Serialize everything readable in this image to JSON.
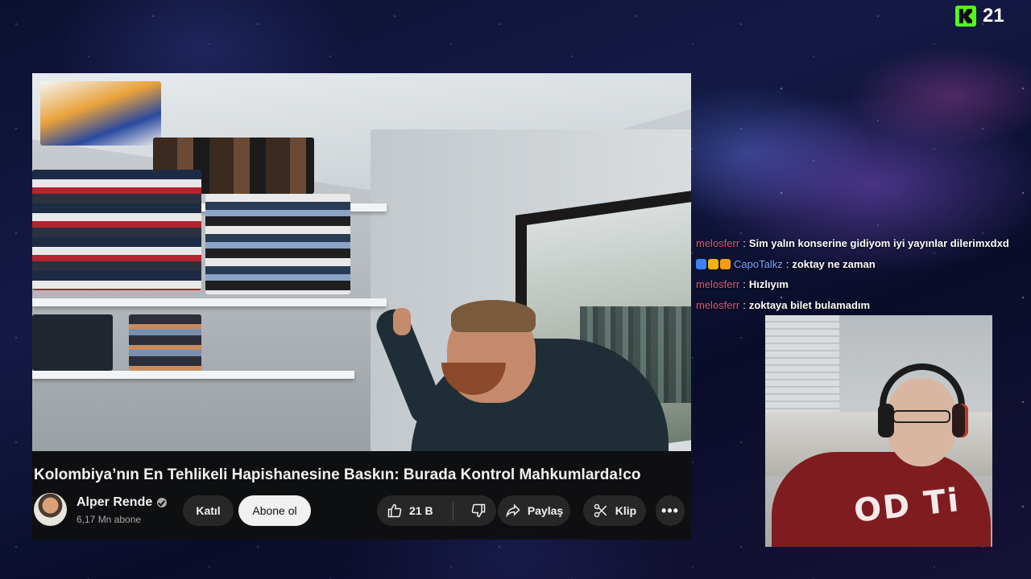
{
  "overlay": {
    "platform_icon": "kick-icon",
    "viewer_count": "21",
    "accent_color": "#53fc18"
  },
  "video": {
    "title": "Kolombiya’nın En Tehlikeli Hapishanesine Baskın: Burada Kontrol Mahkumlarda!co",
    "channel_name": "Alper Rende",
    "subscribers": "6,17 Mn abone",
    "join_label": "Katıl",
    "subscribe_label": "Abone ol",
    "like_count": "21 B",
    "share_label": "Paylaş",
    "clip_label": "Klip",
    "more_label": "•••"
  },
  "chat": {
    "messages": [
      {
        "user": "melosferr",
        "user_color": "#e0577d",
        "text": "Sim yalın konserine gidiyom iyi yayınlar dilerimxdxd",
        "badges": []
      },
      {
        "user": "CapoTalkz",
        "user_color": "#7fa8ff",
        "text": "zoktay ne zaman",
        "badges": [
          "#3b82f6",
          "#f5b301",
          "#f59e0b"
        ]
      },
      {
        "user": "melosferr",
        "user_color": "#e0577d",
        "text": "Hızlıyım",
        "badges": []
      },
      {
        "user": "melosferr",
        "user_color": "#e0577d",
        "text": "zoktaya bilet bulamadım",
        "badges": []
      }
    ]
  },
  "webcam": {
    "shirt_text": "OD Ti"
  }
}
